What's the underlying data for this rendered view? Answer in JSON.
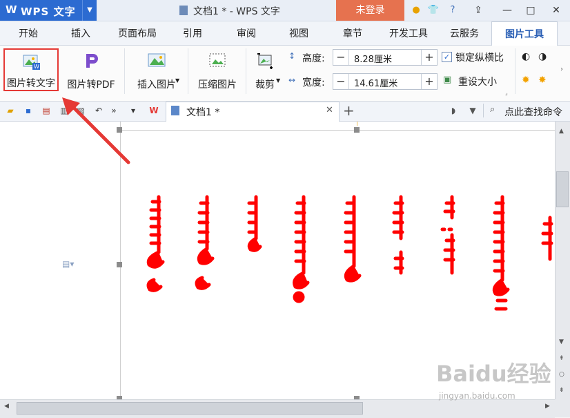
{
  "titlebar": {
    "app_name": "WPS 文字",
    "doc_title": "文档1 * - WPS 文字",
    "login_label": "未登录"
  },
  "menu": {
    "tabs": [
      {
        "label": "开始"
      },
      {
        "label": "插入"
      },
      {
        "label": "页面布局"
      },
      {
        "label": "引用"
      },
      {
        "label": "审阅"
      },
      {
        "label": "视图"
      },
      {
        "label": "章节"
      },
      {
        "label": "开发工具"
      },
      {
        "label": "云服务"
      },
      {
        "label": "图片工具",
        "active": true
      }
    ]
  },
  "ribbon": {
    "img_to_text_label": "图片转文字",
    "img_to_pdf_label": "图片转PDF",
    "insert_image_label": "插入图片",
    "compress_label": "压缩图片",
    "crop_label": "裁剪",
    "height_label": "高度:",
    "height_value": "8.28厘米",
    "width_label": "宽度:",
    "width_value": "14.61厘米",
    "lock_ratio_label": "锁定纵横比",
    "lock_ratio_checked": true,
    "reset_size_label": "重设大小"
  },
  "quickbar": {
    "doc_tab_label": "文档1 *",
    "search_label": "点此查找命令"
  },
  "watermark": {
    "brand": "Baidu经验",
    "url": "jingyan.baidu.com"
  },
  "colors": {
    "accent_blue": "#2c6bd1",
    "login_orange": "#e6724f",
    "highlight_red": "#e53935",
    "mongolian_text": "#ff0000"
  }
}
